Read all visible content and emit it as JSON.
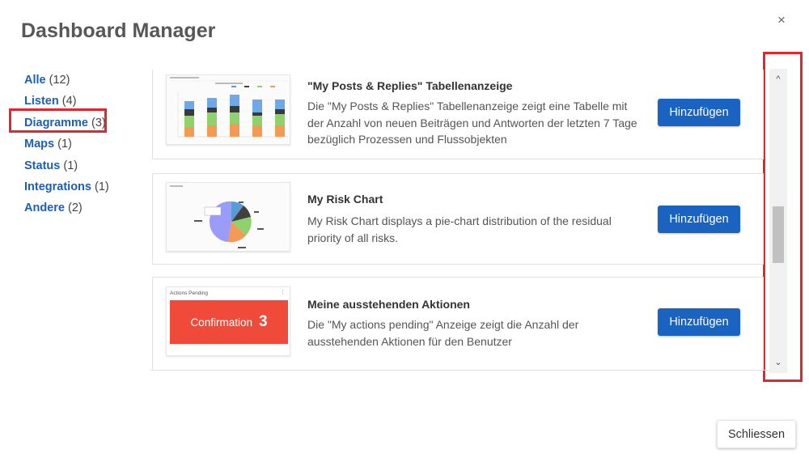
{
  "dialog": {
    "title": "Dashboard Manager",
    "close_glyph": "×",
    "close_button_label": "Schliessen"
  },
  "nav": {
    "items": [
      {
        "label": "Alle",
        "count": "(12)"
      },
      {
        "label": "Listen",
        "count": "(4)"
      },
      {
        "label": "Diagramme",
        "count": "(3)"
      },
      {
        "label": "Maps",
        "count": "(1)"
      },
      {
        "label": "Status",
        "count": "(1)"
      },
      {
        "label": "Integrations",
        "count": "(1)"
      },
      {
        "label": "Andere",
        "count": "(2)"
      }
    ]
  },
  "widgets": [
    {
      "title": "\"My Posts & Replies\" Tabellenanzeige",
      "description": "Die \"My Posts & Replies\" Tabellenanzeige zeigt eine Tabelle mit der Anzahl von neuen Beiträgen und Antworten der letzten 7 Tage bezüglich Prozessen und Flussobjekten",
      "button": "Hinzufügen"
    },
    {
      "title": "My Risk Chart",
      "description": "My Risk Chart displays a pie-chart distribution of the residual priority of all risks.",
      "button": "Hinzufügen"
    },
    {
      "title": "Meine ausstehenden Aktionen",
      "description": "Die \"My actions pending\" Anzeige zeigt die Anzahl der ausstehenden Aktionen für den Benutzer",
      "button": "Hinzufügen"
    }
  ],
  "thumbnails": {
    "pending": {
      "header": "Actions Pending",
      "label": "Confirmation",
      "count": "3"
    }
  },
  "scrollbar": {
    "up_glyph": "^",
    "down_glyph": "⌄"
  },
  "colors": {
    "accent_blue": "#1a63c0",
    "link_blue": "#1b5fb8",
    "highlight_red": "#e3262d",
    "pending_red": "#f04a3a"
  }
}
